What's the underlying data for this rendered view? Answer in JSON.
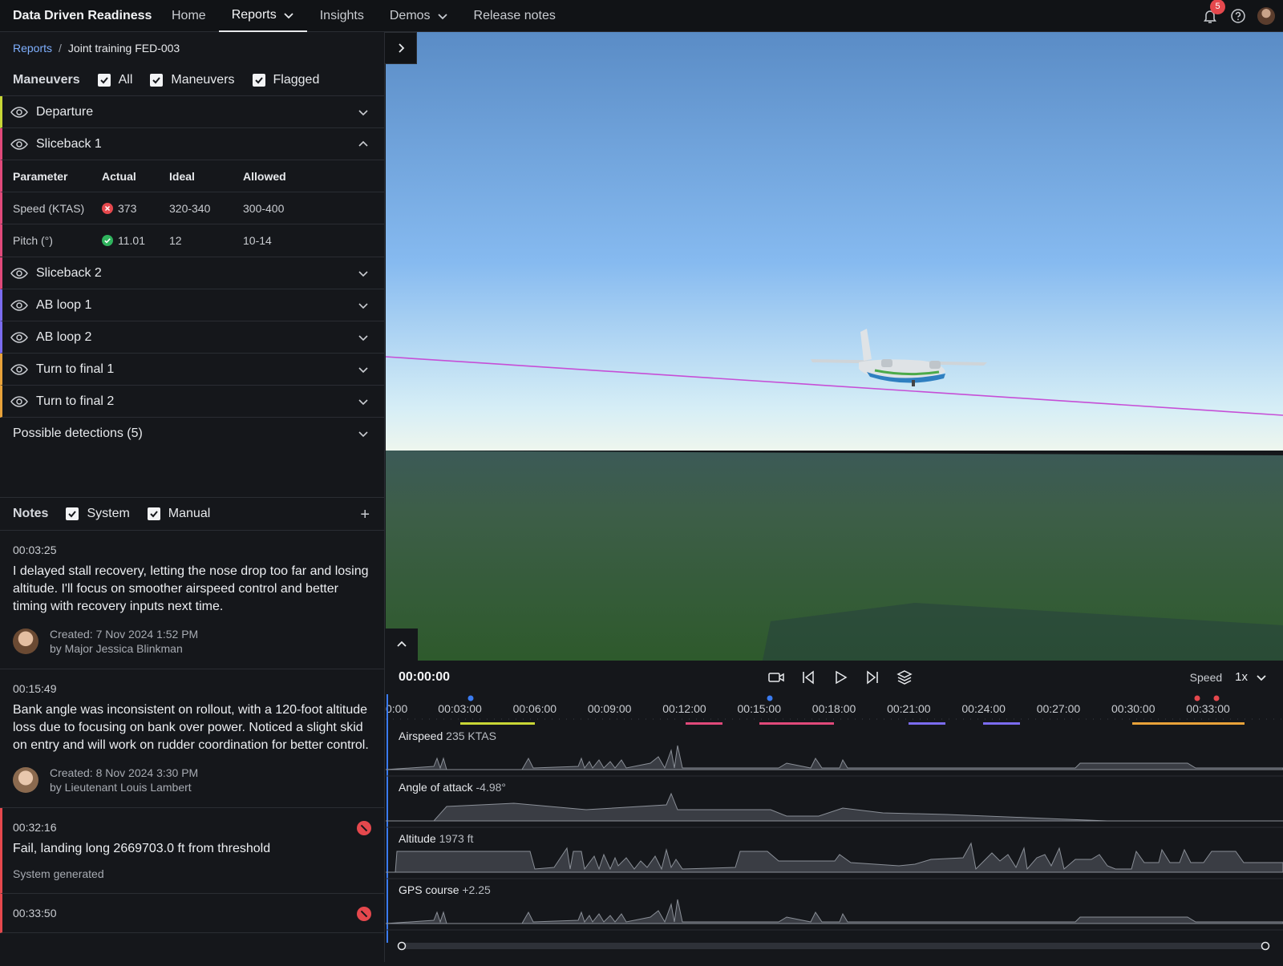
{
  "app": {
    "title": "Data Driven Readiness"
  },
  "nav": {
    "home": "Home",
    "reports": "Reports",
    "insights": "Insights",
    "demos": "Demos",
    "release_notes": "Release notes"
  },
  "header": {
    "notification_count": "5",
    "icons": [
      "bell-icon",
      "help-icon",
      "avatar"
    ]
  },
  "breadcrumb": {
    "root": "Reports",
    "separator": "/",
    "current": "Joint training FED-003"
  },
  "maneuvers": {
    "title": "Maneuvers",
    "filters": [
      {
        "label": "All",
        "checked": true
      },
      {
        "label": "Maneuvers",
        "checked": true
      },
      {
        "label": "Flagged",
        "checked": true
      }
    ],
    "items": [
      {
        "label": "Departure",
        "color": "#c8d636"
      },
      {
        "label": "Sliceback 1",
        "color": "#e0497a",
        "expanded": true
      },
      {
        "label": "Sliceback 2",
        "color": "#e0497a"
      },
      {
        "label": "AB loop 1",
        "color": "#7b6cf0"
      },
      {
        "label": "AB loop 2",
        "color": "#7b6cf0"
      },
      {
        "label": "Turn to final 1",
        "color": "#e8a23a"
      },
      {
        "label": "Turn to final 2",
        "color": "#e8a23a"
      }
    ],
    "params": {
      "headers": [
        "Parameter",
        "Actual",
        "Ideal",
        "Allowed"
      ],
      "rows": [
        {
          "name": "Speed (KTAS)",
          "actual": "373",
          "status": "fail",
          "ideal": "320-340",
          "allowed": "300-400"
        },
        {
          "name": "Pitch (°)",
          "actual": "11.01",
          "status": "pass",
          "ideal": "12",
          "allowed": "10-14"
        }
      ]
    },
    "detections": "Possible detections (5)"
  },
  "notes": {
    "title": "Notes",
    "filters": [
      {
        "label": "System",
        "checked": true
      },
      {
        "label": "Manual",
        "checked": true
      }
    ],
    "add": "+",
    "items": [
      {
        "time": "00:03:25",
        "text": "I delayed stall recovery, letting the nose drop too far and losing altitude. I'll focus on smoother airspeed control and better timing with recovery inputs next time.",
        "created": "Created: 7 Nov 2024 1:52 PM",
        "by": "by Major Jessica Blinkman"
      },
      {
        "time": "00:15:49",
        "text": "Bank angle was inconsistent on rollout, with a 120-foot altitude loss due to focusing on bank over power. Noticed a slight skid on entry and will work on rudder coordination for better control.",
        "created": "Created: 8 Nov 2024 3:30 PM",
        "by": "by Lieutenant Louis Lambert"
      },
      {
        "time": "00:32:16",
        "text": "Fail, landing long 2669703.0 ft from threshold",
        "source": "System generated"
      },
      {
        "time": "00:33:50"
      }
    ]
  },
  "player": {
    "clock": "00:00:00",
    "speed_label": "Speed",
    "speed_value": "1x",
    "ticks": [
      "0:00",
      "00:03:00",
      "00:06:00",
      "00:09:00",
      "00:12:00",
      "00:15:00",
      "00:18:00",
      "00:21:00",
      "00:24:00",
      "00:27:00",
      "00:30:00",
      "00:33:00"
    ]
  },
  "tracks": [
    {
      "label": "Airspeed",
      "value": "235 KTAS"
    },
    {
      "label": "Angle of attack",
      "value": "-4.98°"
    },
    {
      "label": "Altitude",
      "value": "1973 ft"
    },
    {
      "label": "GPS course",
      "value": "+2.25"
    }
  ],
  "colors": {
    "accent": "#7fb0ff",
    "fail": "#e5484d",
    "pass": "#2fb35d",
    "flight_path": "#c64fd6"
  }
}
